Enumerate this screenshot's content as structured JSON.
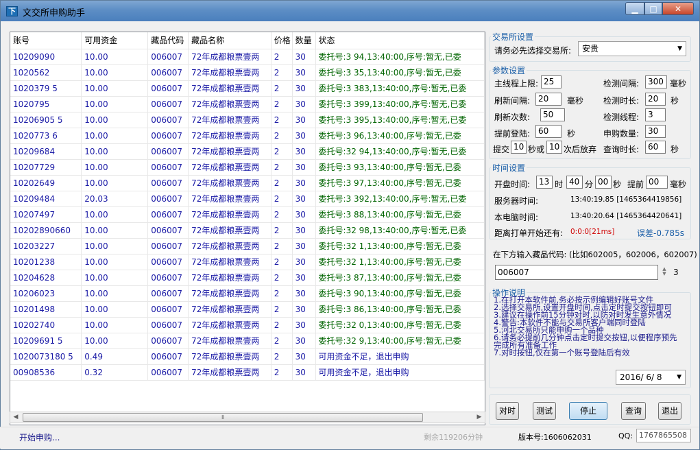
{
  "window": {
    "title": "文交所申购助手",
    "app_icon_glyph": "下"
  },
  "grid": {
    "columns": [
      "账号",
      "可用资金",
      "藏品代码",
      "藏品名称",
      "价格",
      "数量",
      "状态"
    ],
    "rows": [
      {
        "account": "10209090",
        "funds": "10.00",
        "code": "006007",
        "name": "72年成都粮票壹两",
        "price": "2",
        "qty": "30",
        "status": "委托号:3    94,13:40:00,序号:暂无,已委"
      },
      {
        "account": "1020562",
        "funds": "10.00",
        "code": "006007",
        "name": "72年成都粮票壹两",
        "price": "2",
        "qty": "30",
        "status": "委托号:3    35,13:40:00,序号:暂无,已委"
      },
      {
        "account": "1020379  5",
        "funds": "10.00",
        "code": "006007",
        "name": "72年成都粮票壹两",
        "price": "2",
        "qty": "30",
        "status": "委托号:3    383,13:40:00,序号:暂无,已委"
      },
      {
        "account": "1020795",
        "funds": "10.00",
        "code": "006007",
        "name": "72年成都粮票壹两",
        "price": "2",
        "qty": "30",
        "status": "委托号:3    399,13:40:00,序号:暂无,已委"
      },
      {
        "account": "10206905   5",
        "funds": "10.00",
        "code": "006007",
        "name": "72年成都粮票壹两",
        "price": "2",
        "qty": "30",
        "status": "委托号:3    395,13:40:00,序号:暂无,已委"
      },
      {
        "account": "1020773    6",
        "funds": "10.00",
        "code": "006007",
        "name": "72年成都粮票壹两",
        "price": "2",
        "qty": "30",
        "status": "委托号:3    96,13:40:00,序号:暂无,已委"
      },
      {
        "account": "10209684",
        "funds": "10.00",
        "code": "006007",
        "name": "72年成都粮票壹两",
        "price": "2",
        "qty": "30",
        "status": "委托号:32    94,13:40:00,序号:暂无,已委"
      },
      {
        "account": "10207729",
        "funds": "10.00",
        "code": "006007",
        "name": "72年成都粮票壹两",
        "price": "2",
        "qty": "30",
        "status": "委托号:3    93,13:40:00,序号:暂无,已委"
      },
      {
        "account": "10202649",
        "funds": "10.00",
        "code": "006007",
        "name": "72年成都粮票壹两",
        "price": "2",
        "qty": "30",
        "status": "委托号:3    97,13:40:00,序号:暂无,已委"
      },
      {
        "account": "10209484",
        "funds": "20.03",
        "code": "006007",
        "name": "72年成都粮票壹两",
        "price": "2",
        "qty": "30",
        "status": "委托号:3    392,13:40:00,序号:暂无,已委"
      },
      {
        "account": "10207497",
        "funds": "10.00",
        "code": "006007",
        "name": "72年成都粮票壹两",
        "price": "2",
        "qty": "30",
        "status": "委托号:3    88,13:40:00,序号:暂无,已委"
      },
      {
        "account": "10202890660",
        "funds": "10.00",
        "code": "006007",
        "name": "72年成都粮票壹两",
        "price": "2",
        "qty": "30",
        "status": "委托号:32    98,13:40:00,序号:暂无,已委"
      },
      {
        "account": "10203227",
        "funds": "10.00",
        "code": "006007",
        "name": "72年成都粮票壹两",
        "price": "2",
        "qty": "30",
        "status": "委托号:32    1,13:40:00,序号:暂无,已委"
      },
      {
        "account": "10201238",
        "funds": "10.00",
        "code": "006007",
        "name": "72年成都粮票壹两",
        "price": "2",
        "qty": "30",
        "status": "委托号:32    1,13:40:00,序号:暂无,已委"
      },
      {
        "account": "10204628",
        "funds": "10.00",
        "code": "006007",
        "name": "72年成都粮票壹两",
        "price": "2",
        "qty": "30",
        "status": "委托号:3    87,13:40:00,序号:暂无,已委"
      },
      {
        "account": "10206023",
        "funds": "10.00",
        "code": "006007",
        "name": "72年成都粮票壹两",
        "price": "2",
        "qty": "30",
        "status": "委托号:3    90,13:40:00,序号:暂无,已委"
      },
      {
        "account": "10201498",
        "funds": "10.00",
        "code": "006007",
        "name": "72年成都粮票壹两",
        "price": "2",
        "qty": "30",
        "status": "委托号:3    86,13:40:00,序号:暂无,已委"
      },
      {
        "account": "10202740",
        "funds": "10.00",
        "code": "006007",
        "name": "72年成都粮票壹两",
        "price": "2",
        "qty": "30",
        "status": "委托号:32    0,13:40:00,序号:暂无,已委"
      },
      {
        "account": "10209691   5",
        "funds": "10.00",
        "code": "006007",
        "name": "72年成都粮票壹两",
        "price": "2",
        "qty": "30",
        "status": "委托号:32    9,13:40:00,序号:暂无,已委"
      },
      {
        "account": "1020073180  5",
        "funds": "0.49",
        "code": "006007",
        "name": "72年成都粮票壹两",
        "price": "2",
        "qty": "30",
        "status": "可用资金不足，退出申购",
        "fail": true
      },
      {
        "account": "00908536",
        "funds": "0.32",
        "code": "006007",
        "name": "72年成都粮票壹两",
        "price": "2",
        "qty": "30",
        "status": "可用资金不足，退出申购",
        "fail": true
      }
    ]
  },
  "exchange": {
    "legend": "交易所设置",
    "prompt": "请务必先选择交易所:",
    "selected": "安贵"
  },
  "params": {
    "legend": "参数设置",
    "main_thread_label": "主线程上限:",
    "main_thread": "25",
    "check_interval_label": "检测间隔:",
    "check_interval": "300",
    "check_interval_unit": "毫秒",
    "refresh_interval_label": "刷新间隔:",
    "refresh_interval": "20",
    "refresh_interval_unit": "毫秒",
    "check_duration_label": "检测时长:",
    "check_duration": "20",
    "check_duration_unit": "秒",
    "refresh_count_label": "刷新次数:",
    "refresh_count": "50",
    "check_threads_label": "检测线程:",
    "check_threads": "3",
    "early_login_label": "提前登陆:",
    "early_login": "60",
    "early_login_unit": "秒",
    "purchase_qty_label": "申购数量:",
    "purchase_qty": "30",
    "submit_prefix": "提交",
    "submit_seconds": "10",
    "submit_mid": "秒或",
    "submit_times": "10",
    "submit_suffix": "次后放弃",
    "query_duration_label": "查询时长:",
    "query_duration": "60",
    "query_duration_unit": "秒"
  },
  "time": {
    "legend": "时间设置",
    "open_label": "开盘时间:",
    "hour": "13",
    "hour_unit": "时",
    "minute": "40",
    "minute_unit": "分",
    "second": "00",
    "second_unit": "秒",
    "advance_label": "提前",
    "advance": "00",
    "advance_unit": "毫秒",
    "server_label": "服务器时间:",
    "server_value": "13:40:19.85 [1465364419856]",
    "local_label": "本电脑时间:",
    "local_value": "13:40:20.64 [1465364420641]",
    "countdown_label": "距离打单开始还有:",
    "countdown_value": "0:0:0[21ms]",
    "error_label": "误差",
    "error_value": "-0.785s"
  },
  "code_input": {
    "prompt": "在下方输入藏品代码: (比如602005，602006，602007)",
    "value": "006007",
    "count": "3"
  },
  "instructions": {
    "legend": "操作说明",
    "lines": [
      "1.在打开本软件前,务必按示例编辑好账号文件",
      "2.选择交易所,设置开盘时间,点击定时提交按钮即可",
      "3.建议在操作前15分钟对时,以防对时发生意外情况",
      "4.警告:本软件不能与交易所客户端同时登陆",
      "5.河北交易所只能申购一个品种",
      "6.请务必提前几分钟点击定时提交按钮,以便程序预先",
      "完成所有准备工作",
      "7.对时按钮,仅在第一个账号登陆后有效"
    ],
    "date": "2016/ 6/ 8"
  },
  "buttons": {
    "sync": "对时",
    "test": "测试",
    "stop": "停止",
    "query": "查询",
    "exit": "退出"
  },
  "status": {
    "left": "开始申购...",
    "remaining": "剩余119206分钟",
    "version": "版本号:1606062031",
    "qq_label": "QQ:",
    "qq": "1767865508"
  },
  "colors": {
    "accent": "#1a5fa8",
    "row_text": "#1a1aa6",
    "status_ok": "#006400",
    "countdown": "#d00000"
  }
}
